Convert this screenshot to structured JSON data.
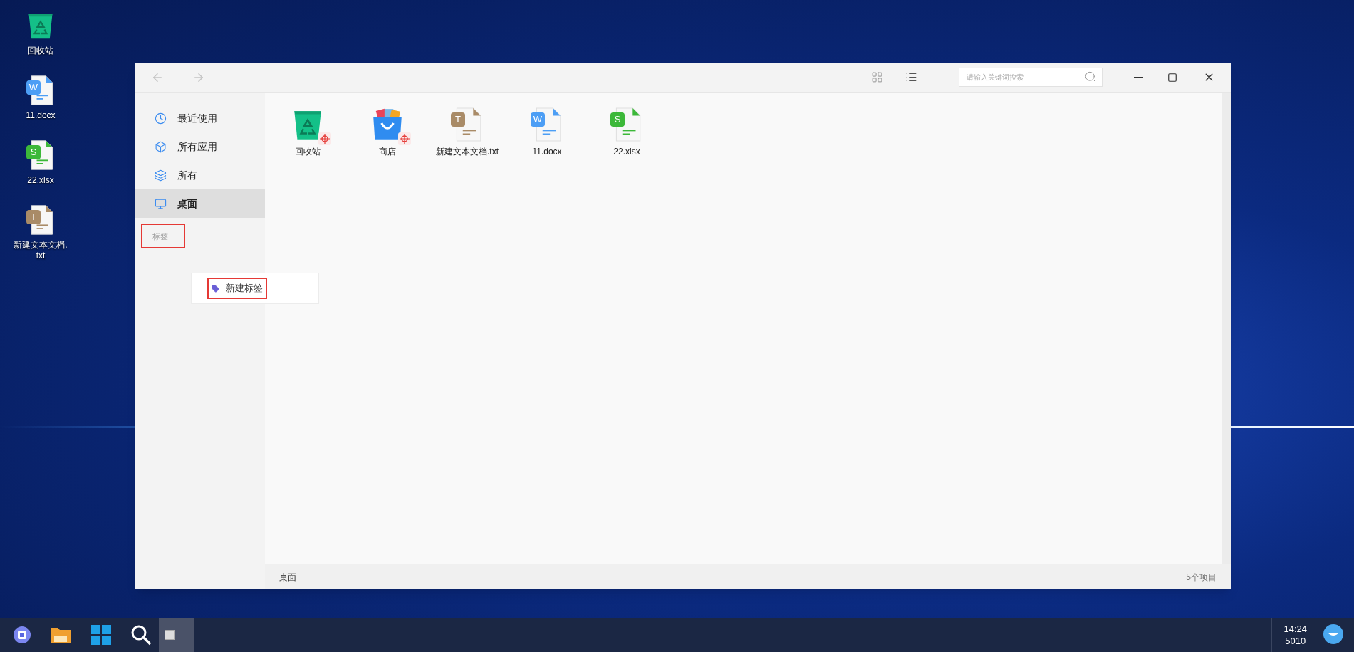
{
  "desktop": {
    "icons": [
      {
        "kind": "recycle",
        "label": "回收站"
      },
      {
        "kind": "docx",
        "letter": "W",
        "label": "11.docx"
      },
      {
        "kind": "xlsx",
        "letter": "S",
        "label": "22.xlsx"
      },
      {
        "kind": "txt",
        "letter": "T",
        "label": "新建文本文档.txt"
      }
    ]
  },
  "window": {
    "toolbar": {
      "back_disabled": true,
      "forward_disabled": true,
      "search": {
        "placeholder": "请输入关键词搜索"
      }
    },
    "sidebar": {
      "items": [
        {
          "kind": "recent",
          "label": "最近使用",
          "selected": false
        },
        {
          "kind": "apps",
          "label": "所有应用",
          "selected": false
        },
        {
          "kind": "all",
          "label": "所有",
          "selected": false
        },
        {
          "kind": "desktop",
          "label": "桌面",
          "selected": true
        }
      ],
      "section": {
        "label": "标签",
        "highlighted": true
      },
      "popup": {
        "label": "新建标签",
        "highlighted": true
      }
    },
    "files": [
      {
        "kind": "recycle",
        "label": "回收站",
        "badge": true
      },
      {
        "kind": "store",
        "label": "商店",
        "badge": true
      },
      {
        "kind": "txt",
        "letter": "T",
        "label": "新建文本文档.txt",
        "badge": false
      },
      {
        "kind": "docx",
        "letter": "W",
        "label": "11.docx",
        "badge": false
      },
      {
        "kind": "xlsx",
        "letter": "S",
        "label": "22.xlsx",
        "badge": false
      }
    ],
    "status_bar": {
      "location": "桌面",
      "count": "5个项目"
    }
  },
  "taskbar": {
    "time": "14:24",
    "date": "5010"
  }
}
